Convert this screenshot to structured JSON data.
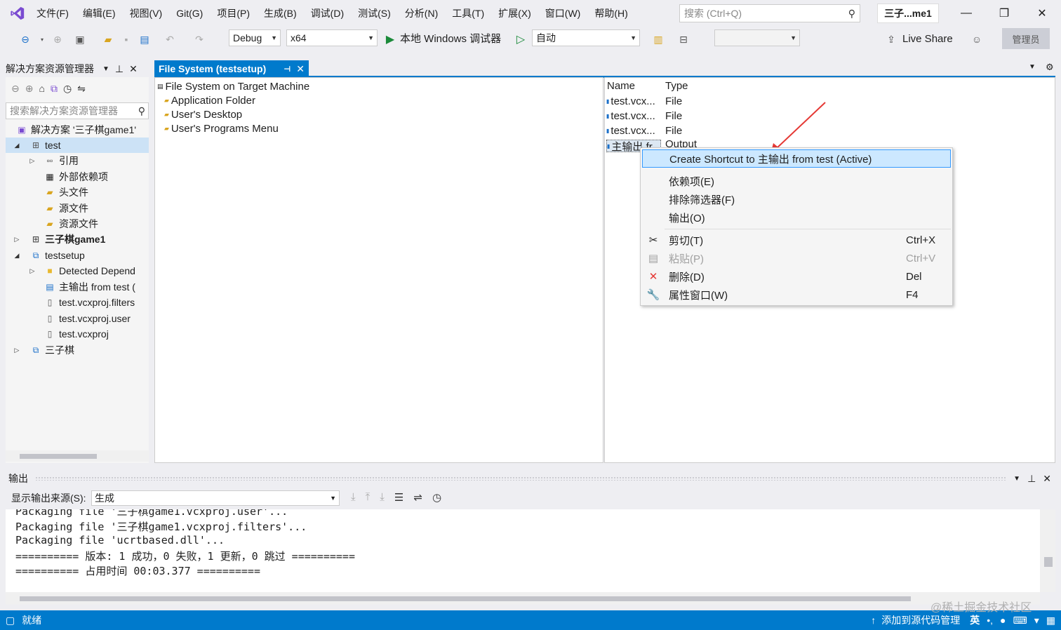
{
  "menubar": {
    "items": [
      "文件(F)",
      "编辑(E)",
      "视图(V)",
      "Git(G)",
      "项目(P)",
      "生成(B)",
      "调试(D)",
      "测试(S)",
      "分析(N)",
      "工具(T)",
      "扩展(X)",
      "窗口(W)",
      "帮助(H)"
    ],
    "search_placeholder": "搜索 (Ctrl+Q)",
    "solution_name": "三子...me1"
  },
  "toolbar": {
    "config": "Debug",
    "platform": "x64",
    "debugger": "本地 Windows 调试器",
    "auto": "自动",
    "live_share": "Live Share",
    "manage": "管理员"
  },
  "solution_explorer": {
    "title": "解决方案资源管理器",
    "search_placeholder": "搜索解决方案资源管理器",
    "items": [
      {
        "label": "解决方案 '三子棋game1'",
        "icon": "solution-icon"
      },
      {
        "label": "test",
        "icon": "project-icon"
      },
      {
        "label": "引用",
        "icon": "references-icon"
      },
      {
        "label": "外部依赖项",
        "icon": "external-deps-icon"
      },
      {
        "label": "头文件",
        "icon": "filter-folder-icon"
      },
      {
        "label": "源文件",
        "icon": "filter-folder-icon"
      },
      {
        "label": "资源文件",
        "icon": "filter-folder-icon"
      },
      {
        "label": "三子棋game1",
        "icon": "project-icon"
      },
      {
        "label": "testsetup",
        "icon": "setup-project-icon"
      },
      {
        "label": "Detected Depend",
        "icon": "folder-icon"
      },
      {
        "label": "主输出 from test (",
        "icon": "output-icon"
      },
      {
        "label": "test.vcxproj.filters",
        "icon": "file-icon"
      },
      {
        "label": "test.vcxproj.user",
        "icon": "file-icon"
      },
      {
        "label": "test.vcxproj",
        "icon": "file-icon"
      },
      {
        "label": "三子棋",
        "icon": "setup-project-icon"
      }
    ]
  },
  "document": {
    "tab_title": "File System (testsetup)",
    "tree": [
      "File System on Target Machine",
      "Application Folder",
      "User's Desktop",
      "User's Programs Menu"
    ],
    "list_headers": [
      "Name",
      "Type"
    ],
    "list_rows": [
      {
        "name": "test.vcx...",
        "type": "File"
      },
      {
        "name": "test.vcx...",
        "type": "File"
      },
      {
        "name": "test.vcx...",
        "type": "File"
      },
      {
        "name": "主输出 fr...",
        "type": "Output"
      }
    ]
  },
  "context_menu": {
    "items": [
      {
        "label": "Create Shortcut to 主输出 from test (Active)",
        "shortcut": ""
      },
      {
        "label": "依赖项(E)",
        "shortcut": ""
      },
      {
        "label": "排除筛选器(F)",
        "shortcut": ""
      },
      {
        "label": "输出(O)",
        "shortcut": ""
      },
      {
        "label": "剪切(T)",
        "shortcut": "Ctrl+X"
      },
      {
        "label": "粘贴(P)",
        "shortcut": "Ctrl+V"
      },
      {
        "label": "删除(D)",
        "shortcut": "Del"
      },
      {
        "label": "属性窗口(W)",
        "shortcut": "F4"
      }
    ]
  },
  "output": {
    "title": "输出",
    "source_label": "显示输出来源(S):",
    "source_value": "生成",
    "lines": [
      "Packaging file '三子棋game1.vcxproj.user'...",
      "Packaging file '三子棋game1.vcxproj.filters'...",
      "Packaging file 'ucrtbased.dll'...",
      "========== 版本: 1 成功，0 失败，1 更新，0 跳过 ==========",
      "========== 占用时间 00:03.377 =========="
    ]
  },
  "statusbar": {
    "ready": "就绪",
    "source_control": "添加到源代码管理",
    "watermark": "@稀土掘金技术社区",
    "ime": "英"
  },
  "colors": {
    "accent": "#007acc",
    "highlight": "#cce8ff",
    "arrow": "#e53935"
  }
}
